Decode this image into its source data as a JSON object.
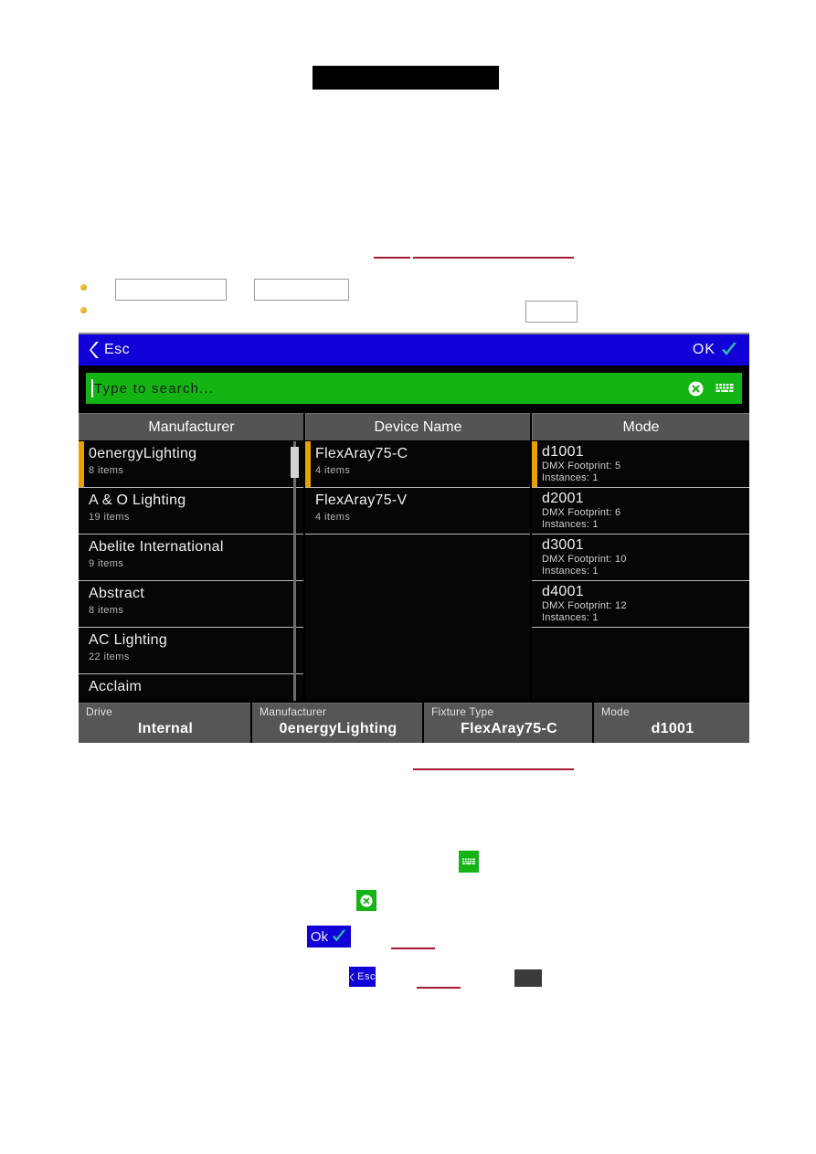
{
  "dialog": {
    "titlebar": {
      "back_label": "Esc",
      "back_icon": "chevron-left-icon",
      "confirm_label": "OK",
      "confirm_icon": "check-icon",
      "background_color": "#1100d8"
    },
    "search": {
      "placeholder": "Type to search...",
      "value": "",
      "background_color": "#15b415",
      "clear_icon": "clear-circle-x-icon",
      "keyboard_icon": "keyboard-icon"
    },
    "columns": [
      {
        "header": "Manufacturer",
        "selected_index": 0,
        "rows": [
          {
            "name": "0energyLighting",
            "sub": "8 items"
          },
          {
            "name": "A & O Lighting",
            "sub": "19 items"
          },
          {
            "name": "Abelite International",
            "sub": "9 items"
          },
          {
            "name": "Abstract",
            "sub": "8 items"
          },
          {
            "name": "AC Lighting",
            "sub": "22 items"
          },
          {
            "name": "Acclaim",
            "sub": ""
          }
        ]
      },
      {
        "header": "Device Name",
        "selected_index": 0,
        "rows": [
          {
            "name": "FlexAray75-C",
            "sub": "4 items"
          },
          {
            "name": "FlexAray75-V",
            "sub": "4 items"
          }
        ]
      },
      {
        "header": "Mode",
        "selected_index": 0,
        "rows": [
          {
            "name": "d1001",
            "sub": "DMX Footprint: 5",
            "sub2": "Instances: 1"
          },
          {
            "name": "d2001",
            "sub": "DMX Footprint: 6",
            "sub2": "Instances: 1"
          },
          {
            "name": "d3001",
            "sub": "DMX Footprint: 10",
            "sub2": "Instances: 1"
          },
          {
            "name": "d4001",
            "sub": "DMX Footprint: 12",
            "sub2": "Instances: 1"
          }
        ]
      }
    ],
    "status": [
      {
        "label": "Drive",
        "value": "Internal"
      },
      {
        "label": "Manufacturer",
        "value": "0energyLighting"
      },
      {
        "label": "Fixture Type",
        "value": "FlexAray75-C"
      },
      {
        "label": "Mode",
        "value": "d1001"
      }
    ],
    "selection_accent_color": "#e8a200"
  },
  "inline_icons": {
    "keyboard": "keyboard-icon",
    "clear": "clear-circle-x-icon",
    "ok_label": "Ok",
    "ok_icon": "check-icon",
    "esc_label": "Esc",
    "esc_icon": "chevron-left-icon"
  }
}
